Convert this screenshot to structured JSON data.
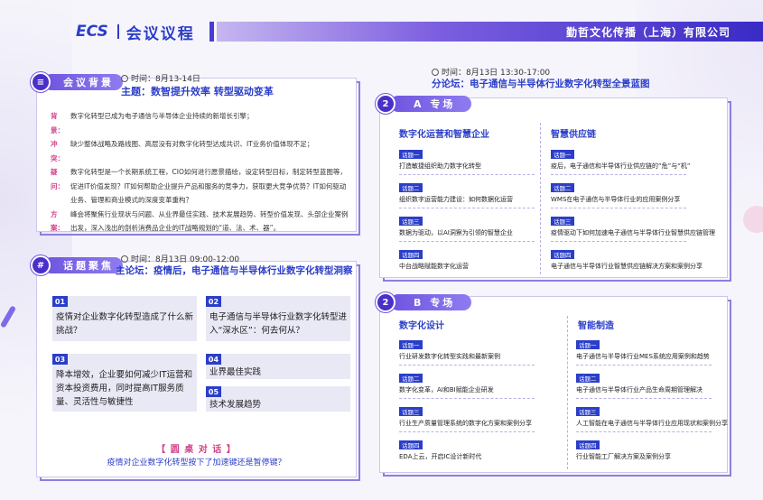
{
  "header": {
    "logo": "ECS",
    "title": "会议议程",
    "company": "勤哲文化传播（上海）有限公司"
  },
  "background": {
    "tag": "会议背景",
    "time": "时间：8月13-14日",
    "theme": "主题：数智提升效率  转型驱动变革",
    "rows": [
      {
        "key": "背景：",
        "text": "数字化转型已成为电子通信与半导体企业持续的新增长引擎；"
      },
      {
        "key": "冲突：",
        "text": "缺少整体战略及路线图、高层没有对数字化转型达成共识、IT业务价值体现不足；"
      },
      {
        "key": "疑问：",
        "text": "数字化转型是一个长期系统工程，CIO如何进行愿景描绘，设定转型目标，制定转型蓝图等，促进IT价值发现？IT如何帮助企业提升产品和服务的竞争力，获取更大竞争优势？IT如何驱动业务、管理和商业模式的深度变革重构？"
      },
      {
        "key": "方案：",
        "text": "峰会将聚焦行业现状与问题、从业界最佳实践、技术发展趋势、转型价值发现、头部企业案例出发，深入浅出的剖析消费品企业的IT战略规划的“道、法、术、器”。"
      }
    ]
  },
  "topics": {
    "tag": "话题聚焦",
    "time": "时间：8月13日 09:00-12:00",
    "theme": "主论坛：疫情后，电子通信与半导体行业数字化转型洞察",
    "items": [
      {
        "num": "01",
        "text": "疫情对企业数字化转型造成了什么新挑战？"
      },
      {
        "num": "02",
        "text": "电子通信与半导体行业数字化转型进入“深水区”：何去何从？"
      },
      {
        "num": "03",
        "text": "降本增效，企业要如何减少IT运营和资本投资费用，同时提高IT服务质量、灵活性与敏捷性"
      },
      {
        "num": "04",
        "text": "业界最佳实践"
      },
      {
        "num": "05",
        "text": "技术发展趋势"
      }
    ],
    "round_title": "【 圆 桌 对 话 】",
    "round_text": "疫情对企业数字化转型按下了加速键还是暂停键？"
  },
  "forum": {
    "time": "时间：8月13日 13:30-17:00",
    "theme": "分论坛：电子通信与半导体行业数字化转型全景蓝图"
  },
  "session_a": {
    "tag": "A 专场",
    "icon": "2",
    "left_head": "数字化运营和智慧企业",
    "right_head": "智慧供应链",
    "left": [
      {
        "label": "话题一",
        "text": "打造敏捷组织助力数字化转型"
      },
      {
        "label": "话题二",
        "text": "组织数字运营能力建设：如何数据化运营"
      },
      {
        "label": "话题三",
        "text": "数据为驱动，以AI洞察为引领的智慧企业"
      },
      {
        "label": "话题四",
        "text": "中台战略赋能数字化运营"
      }
    ],
    "right": [
      {
        "label": "话题一",
        "text": "疫后，电子通信和半导体行业供应链的“危”与“机”"
      },
      {
        "label": "话题二",
        "text": "WMS在电子通信与半导体行业的应用案例分享"
      },
      {
        "label": "话题三",
        "text": "疫情驱动下如何加速电子通信与半导体行业智慧供应链管理"
      },
      {
        "label": "话题四",
        "text": "电子通信与半导体行业智慧供应链解决方案和案例分享"
      }
    ]
  },
  "session_b": {
    "tag": "B 专场",
    "icon": "2",
    "left_head": "数字化设计",
    "right_head": "智能制造",
    "left": [
      {
        "label": "话题一",
        "text": "行业研发数字化转型实践和最新案例"
      },
      {
        "label": "话题二",
        "text": "数字化变革，AI和BI赋能企业研发"
      },
      {
        "label": "话题三",
        "text": "行业生产质量管理系统的数字化方案和案例分享"
      },
      {
        "label": "话题四",
        "text": "EDA上云，开启IC设计新时代"
      }
    ],
    "right": [
      {
        "label": "话题一",
        "text": "电子通信与半导体行业MES系统应用案例和趋势"
      },
      {
        "label": "话题二",
        "text": "电子通信与半导体行业产品生命周期管理解决"
      },
      {
        "label": "话题三",
        "text": "人工智能在电子通信与半导体行业应用现状和案例分享"
      },
      {
        "label": "话题四",
        "text": "行业智能工厂解决方案及案例分享"
      }
    ]
  },
  "colors": {
    "primary": "#2b3ec9",
    "accent": "#d1428a",
    "violet": "#6f54e0"
  },
  "icons": {
    "clock": "clock-icon",
    "background": "chat-icon",
    "topics": "hash-icon",
    "session": "pencil-icon"
  }
}
